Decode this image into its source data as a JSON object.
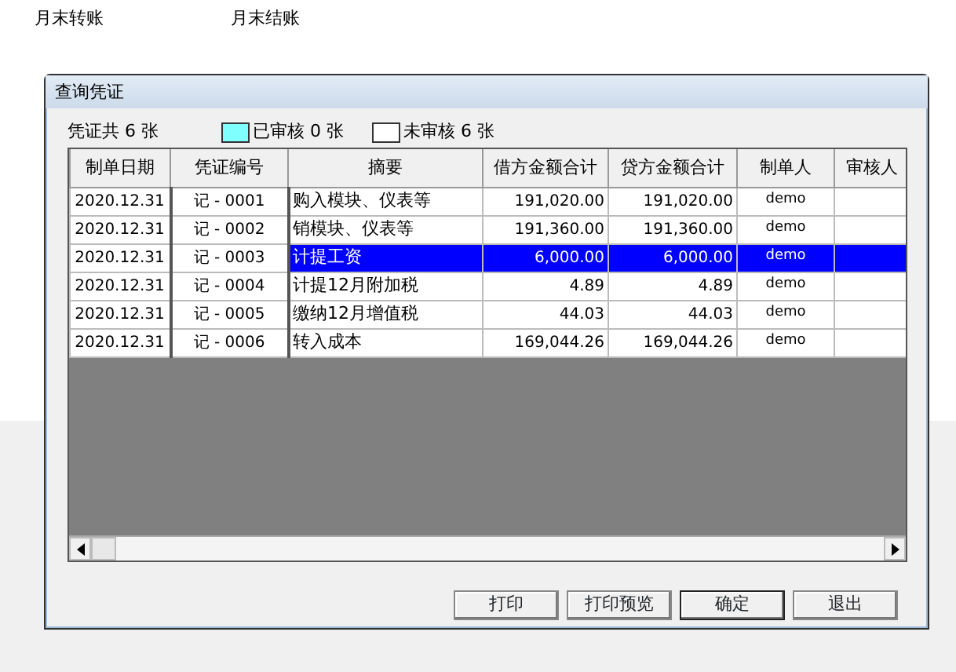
{
  "top_links": [
    "月末转账",
    "月末结账"
  ],
  "dialog": {
    "title": "查询凭证",
    "summary": {
      "total": "凭证共 6 张",
      "legend": [
        {
          "label": "已审核 0 张",
          "color": "#80ffff"
        },
        {
          "label": "未审核 6 张",
          "color": "#ffffff"
        }
      ]
    },
    "table": {
      "columns": [
        "制单日期",
        "凭证编号",
        "摘要",
        "借方金额合计",
        "贷方金额合计",
        "制单人",
        "审核人"
      ],
      "rows": [
        {
          "cells": [
            "2020.12.31",
            "记 - 0001",
            "购入模块、仪表等",
            "191,020.00",
            "191,020.00",
            "demo",
            ""
          ],
          "selected": false
        },
        {
          "cells": [
            "2020.12.31",
            "记 - 0002",
            "销模块、仪表等",
            "191,360.00",
            "191,360.00",
            "demo",
            ""
          ],
          "selected": false
        },
        {
          "cells": [
            "2020.12.31",
            "记 - 0003",
            "计提工资",
            "6,000.00",
            "6,000.00",
            "demo",
            ""
          ],
          "selected": true
        },
        {
          "cells": [
            "2020.12.31",
            "记 - 0004",
            "计提12月附加税",
            "4.89",
            "4.89",
            "demo",
            ""
          ],
          "selected": false
        },
        {
          "cells": [
            "2020.12.31",
            "记 - 0005",
            "缴纳12月增值税",
            "44.03",
            "44.03",
            "demo",
            ""
          ],
          "selected": false
        },
        {
          "cells": [
            "2020.12.31",
            "记 - 0006",
            "转入成本",
            "169,044.26",
            "169,044.26",
            "demo",
            ""
          ],
          "selected": false
        }
      ]
    },
    "buttons": [
      {
        "label": "打印",
        "default": false
      },
      {
        "label": "打印预览",
        "default": false
      },
      {
        "label": "确定",
        "default": true
      },
      {
        "label": "退出",
        "default": false
      }
    ]
  }
}
